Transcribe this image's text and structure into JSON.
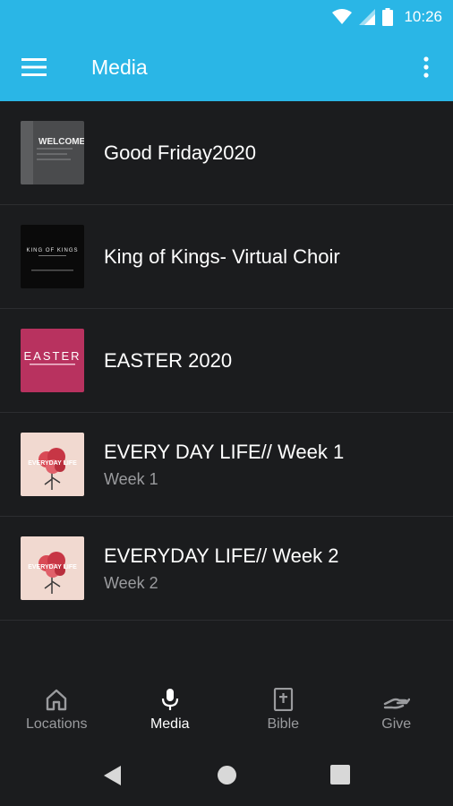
{
  "status_bar": {
    "time": "10:26"
  },
  "app_bar": {
    "title": "Media"
  },
  "media_items": [
    {
      "title": "Good Friday2020",
      "subtitle": "",
      "thumb_text": "WELCOME"
    },
    {
      "title": "King of Kings- Virtual Choir",
      "subtitle": "",
      "thumb_text": "KING OF KINGS"
    },
    {
      "title": "EASTER 2020",
      "subtitle": "",
      "thumb_text": "EASTER"
    },
    {
      "title": "EVERY DAY LIFE// Week 1",
      "subtitle": "Week 1",
      "thumb_text": "EVERYDAY LIFE"
    },
    {
      "title": "EVERYDAY LIFE// Week 2",
      "subtitle": "Week 2",
      "thumb_text": "EVERYDAY LIFE"
    }
  ],
  "bottom_nav": [
    {
      "label": "Locations",
      "icon": "home-icon",
      "active": false
    },
    {
      "label": "Media",
      "icon": "microphone-icon",
      "active": true
    },
    {
      "label": "Bible",
      "icon": "bible-icon",
      "active": false
    },
    {
      "label": "Give",
      "icon": "hand-icon",
      "active": false
    }
  ],
  "colors": {
    "app_bar": "#2ab6e6",
    "background": "#1b1c1e",
    "easter_thumb": "#b8325f"
  }
}
